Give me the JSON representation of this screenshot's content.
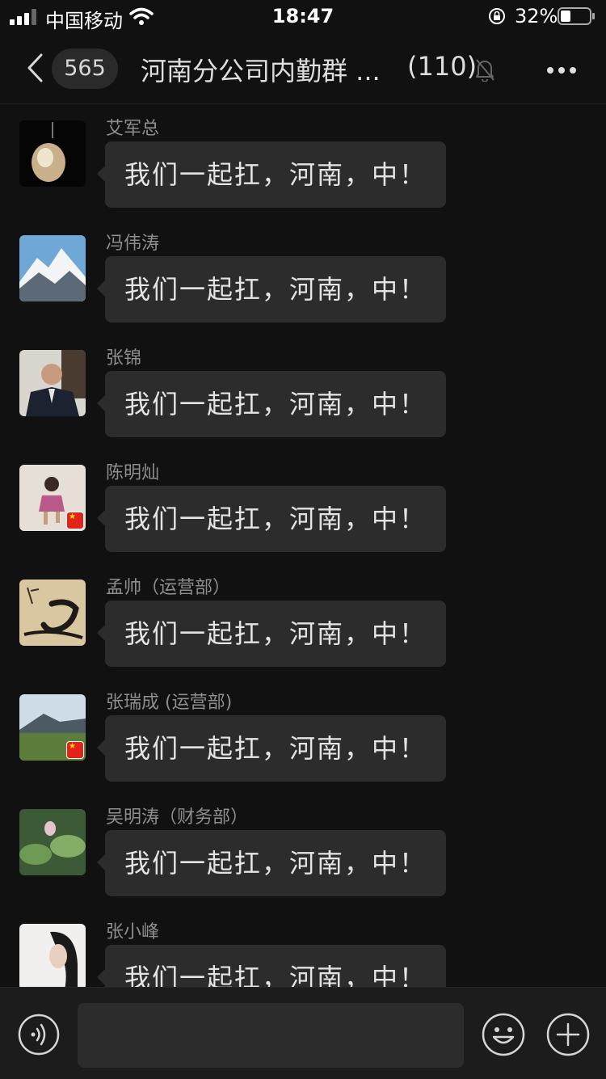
{
  "status_bar": {
    "carrier": "中国移动",
    "time": "18:47",
    "battery": "32%"
  },
  "header": {
    "back_count": "565",
    "title": "河南分公司内勤群 ...",
    "member_count": "(110)"
  },
  "messages": [
    {
      "sender": "艾军总",
      "text": "我们一起扛，河南，中！",
      "avatar": "pendant-avatar"
    },
    {
      "sender": "冯伟涛",
      "text": "我们一起扛，河南，中！",
      "avatar": "mountain-avatar"
    },
    {
      "sender": "张锦",
      "text": "我们一起扛，河南，中！",
      "avatar": "man-in-suit-avatar"
    },
    {
      "sender": "陈明灿",
      "text": "我们一起扛，河南，中！",
      "avatar": "child-avatar"
    },
    {
      "sender": "孟帅（运营部）",
      "text": "我们一起扛，河南，中！",
      "avatar": "calligraphy-avatar"
    },
    {
      "sender": "张瑞成 (运营部)",
      "text": "我们一起扛，河南，中！",
      "avatar": "landscape-avatar"
    },
    {
      "sender": "吴明涛（财务部）",
      "text": "我们一起扛，河南，中！",
      "avatar": "lotus-avatar"
    },
    {
      "sender": "张小峰",
      "text": "我们一起扛，河南，中！",
      "avatar": "woman-avatar"
    }
  ],
  "colors": {
    "background": "#111111",
    "bubble": "#2c2c2c",
    "input_bar": "#1c1c1c"
  }
}
